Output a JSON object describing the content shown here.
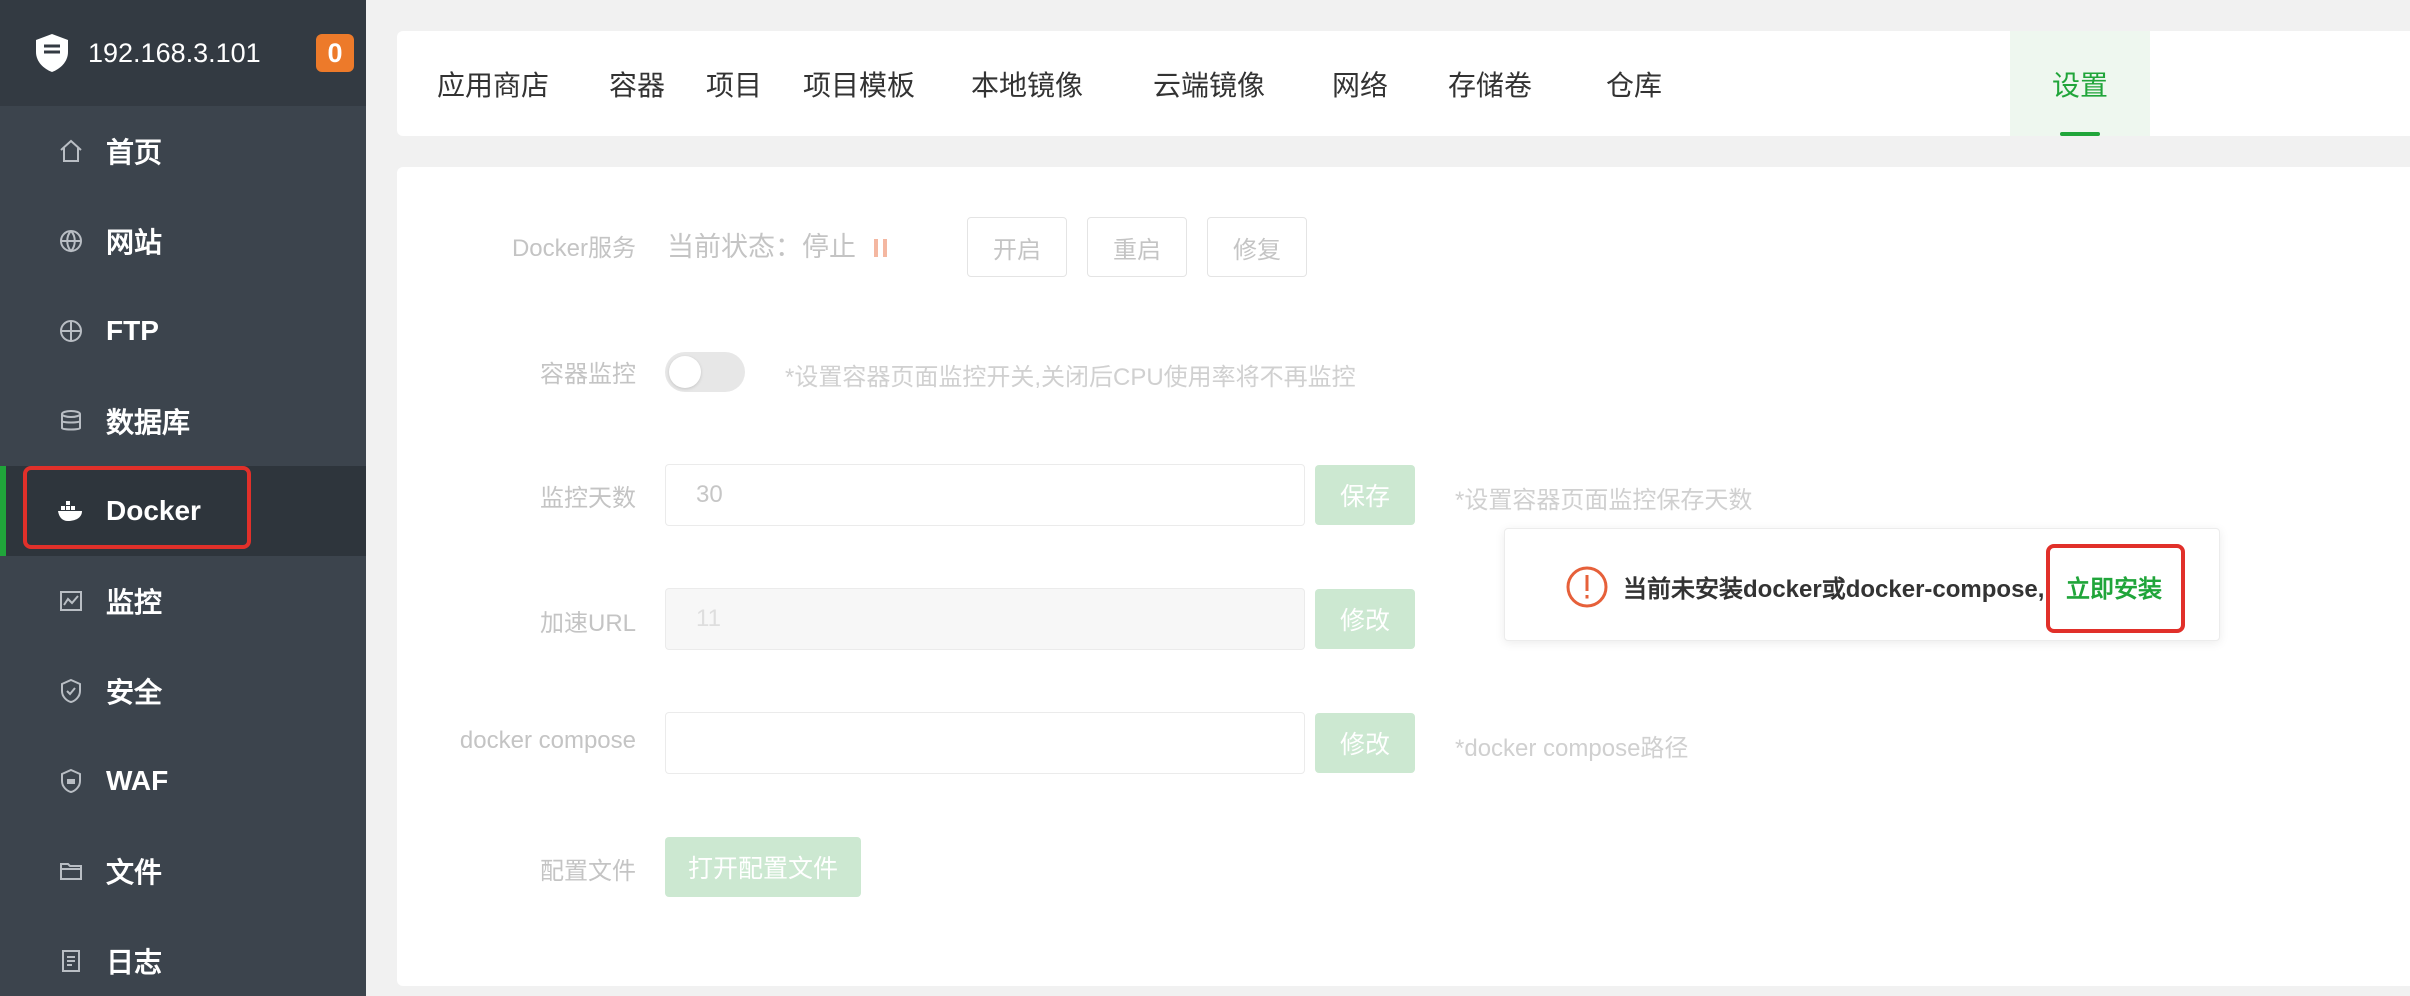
{
  "sidebar": {
    "server_ip": "192.168.3.101",
    "badge_count": "0",
    "items": [
      {
        "label": "首页",
        "icon": "home-icon"
      },
      {
        "label": "网站",
        "icon": "globe-icon"
      },
      {
        "label": "FTP",
        "icon": "ftp-globe-icon"
      },
      {
        "label": "数据库",
        "icon": "database-icon"
      },
      {
        "label": "Docker",
        "icon": "docker-icon",
        "active": true
      },
      {
        "label": "监控",
        "icon": "monitor-icon"
      },
      {
        "label": "安全",
        "icon": "shield-icon"
      },
      {
        "label": "WAF",
        "icon": "waf-shield-icon"
      },
      {
        "label": "文件",
        "icon": "folder-icon"
      },
      {
        "label": "日志",
        "icon": "log-icon"
      }
    ]
  },
  "tabs": [
    {
      "label": "应用商店"
    },
    {
      "label": "容器"
    },
    {
      "label": "项目"
    },
    {
      "label": "项目模板"
    },
    {
      "label": "本地镜像"
    },
    {
      "label": "云端镜像"
    },
    {
      "label": "网络"
    },
    {
      "label": "存储卷"
    },
    {
      "label": "仓库"
    },
    {
      "label": "设置",
      "active": true
    }
  ],
  "settings": {
    "docker_service": {
      "label": "Docker服务",
      "status_text": "当前状态：停止",
      "start_label": "开启",
      "restart_label": "重启",
      "repair_label": "修复"
    },
    "container_monitor": {
      "label": "容器监控",
      "enabled": false,
      "hint": "*设置容器页面监控开关,关闭后CPU使用率将不再监控"
    },
    "monitor_days": {
      "label": "监控天数",
      "value": "30",
      "save_label": "保存",
      "hint": "*设置容器页面监控保存天数"
    },
    "accel_url": {
      "label": "加速URL",
      "value": "11",
      "edit_label": "修改"
    },
    "docker_compose": {
      "label": "docker compose",
      "value": "",
      "edit_label": "修改",
      "hint": "*docker compose路径"
    },
    "config_file": {
      "label": "配置文件",
      "open_label": "打开配置文件"
    }
  },
  "popup": {
    "message": "当前未安装docker或docker-compose,",
    "install_label": "立即安装"
  },
  "colors": {
    "accent": "#20a53a",
    "sidebar_bg": "#3c444d",
    "badge": "#ed7a2a",
    "highlight": "#e1302a"
  }
}
